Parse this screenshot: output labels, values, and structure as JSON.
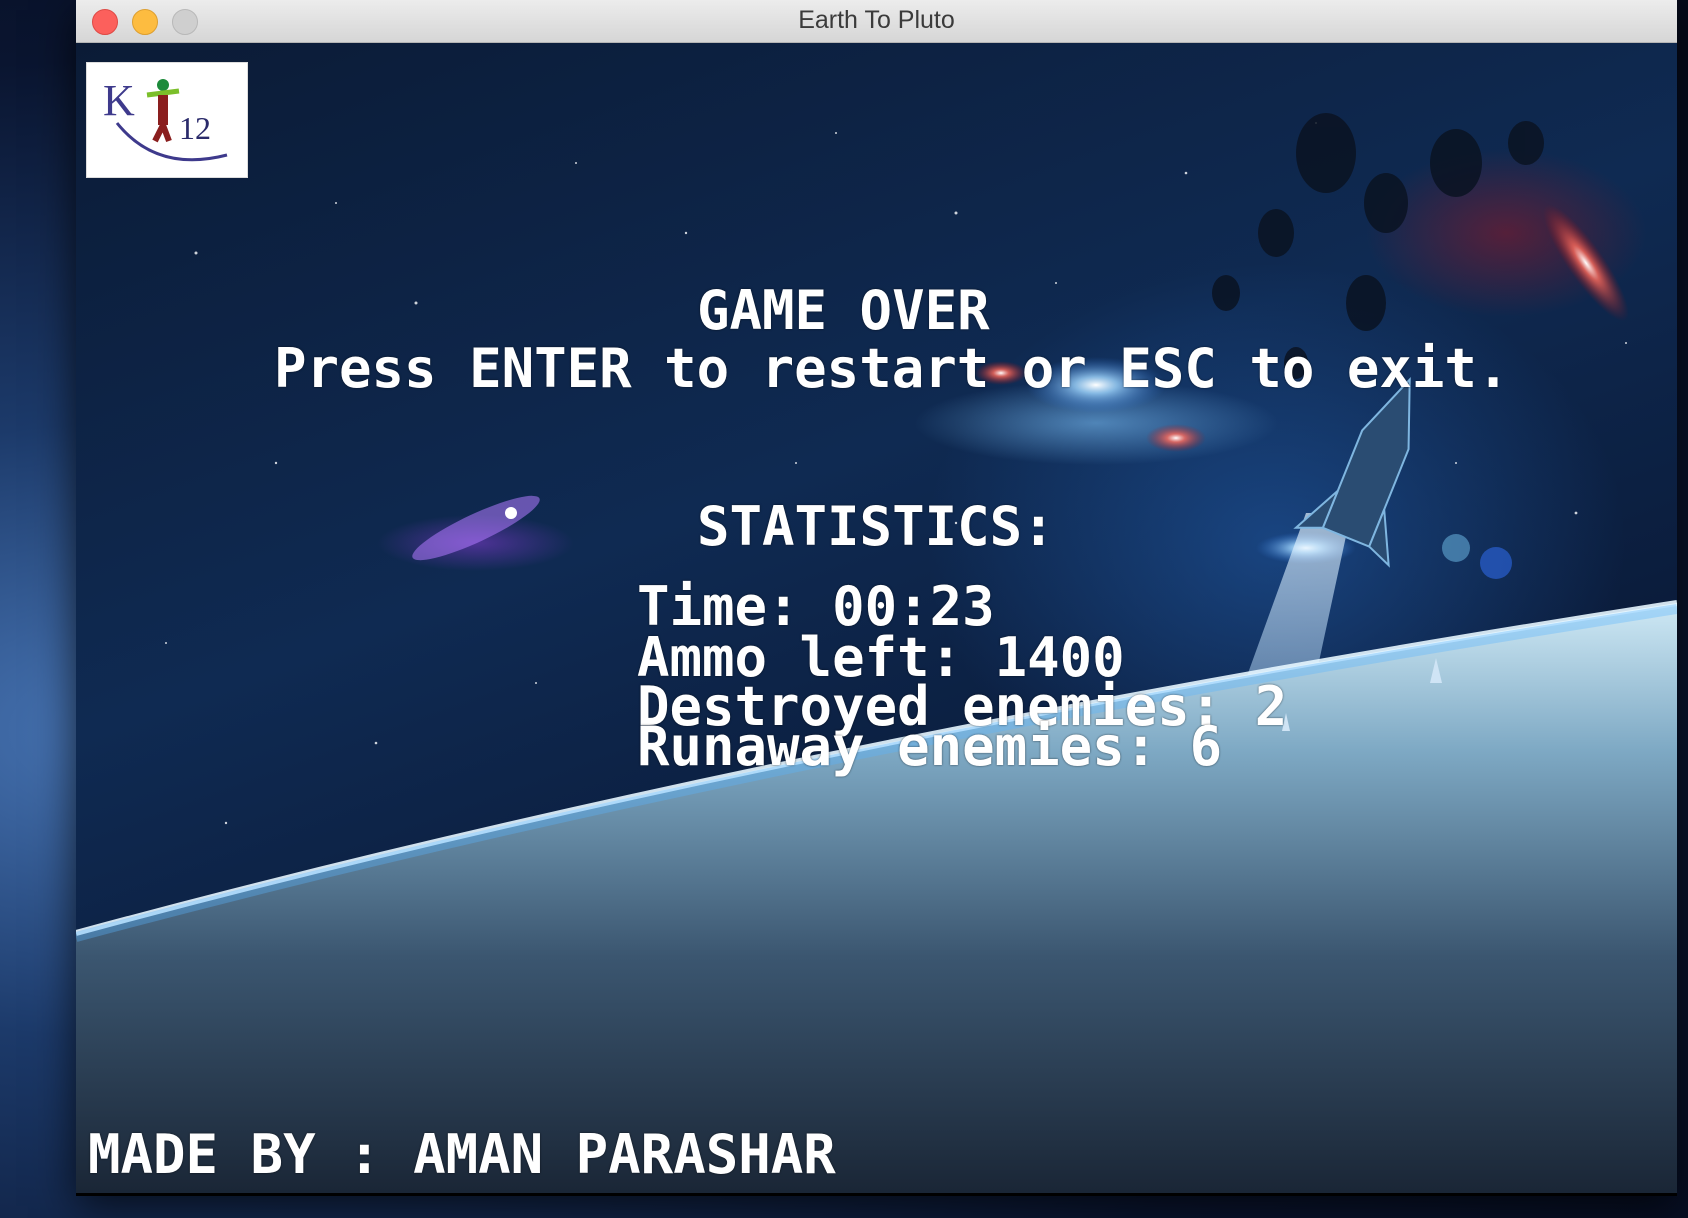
{
  "window": {
    "title": "Earth To Pluto"
  },
  "logo": {
    "alt": "K12 logo",
    "text": "K12"
  },
  "game_over": {
    "title": "GAME OVER",
    "instructions": "Press ENTER to restart or ESC to exit."
  },
  "statistics": {
    "heading": "STATISTICS:",
    "time": "Time: 00:23",
    "ammo": "Ammo left: 1400",
    "destroyed": "Destroyed enemies: 2",
    "runaway": "Runaway enemies: 6"
  },
  "credit": "MADE BY : AMAN PARASHAR",
  "colors": {
    "text": "#ffffff",
    "close": "#fc605c",
    "minimize": "#fdbc40",
    "maximize": "#cfcfcf"
  }
}
